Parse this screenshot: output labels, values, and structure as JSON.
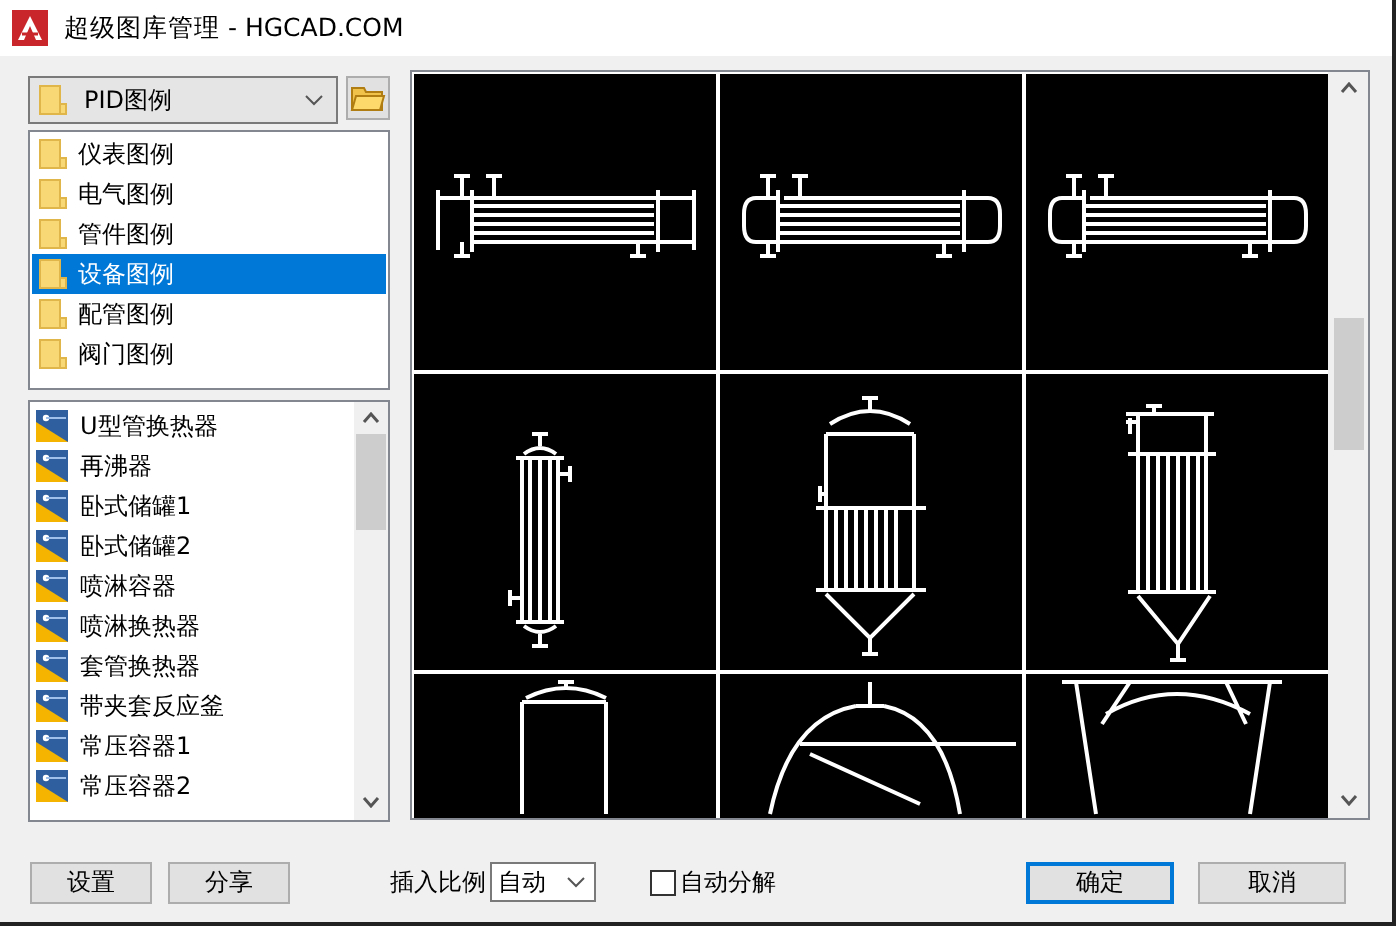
{
  "window": {
    "title": "超级图库管理 - HGCAD.COM"
  },
  "library_select": {
    "value": "PID图例"
  },
  "categories": [
    {
      "label": "仪表图例",
      "selected": false
    },
    {
      "label": "电气图例",
      "selected": false
    },
    {
      "label": "管件图例",
      "selected": false
    },
    {
      "label": "设备图例",
      "selected": true
    },
    {
      "label": "配管图例",
      "selected": false
    },
    {
      "label": "阀门图例",
      "selected": false
    }
  ],
  "symbols": [
    "U型管换热器",
    "再沸器",
    "卧式储罐1",
    "卧式储罐2",
    "喷淋容器",
    "喷淋换热器",
    "套管换热器",
    "带夹套反应釜",
    "常压容器1",
    "常压容器2"
  ],
  "left_buttons": [
    "设置",
    "分享"
  ],
  "scale": {
    "label": "插入比例",
    "value": "自动"
  },
  "auto_explode": {
    "label": "自动分解",
    "checked": false
  },
  "dialog_buttons": [
    {
      "label": "确定",
      "focused": true
    },
    {
      "label": "取消",
      "focused": false
    }
  ]
}
